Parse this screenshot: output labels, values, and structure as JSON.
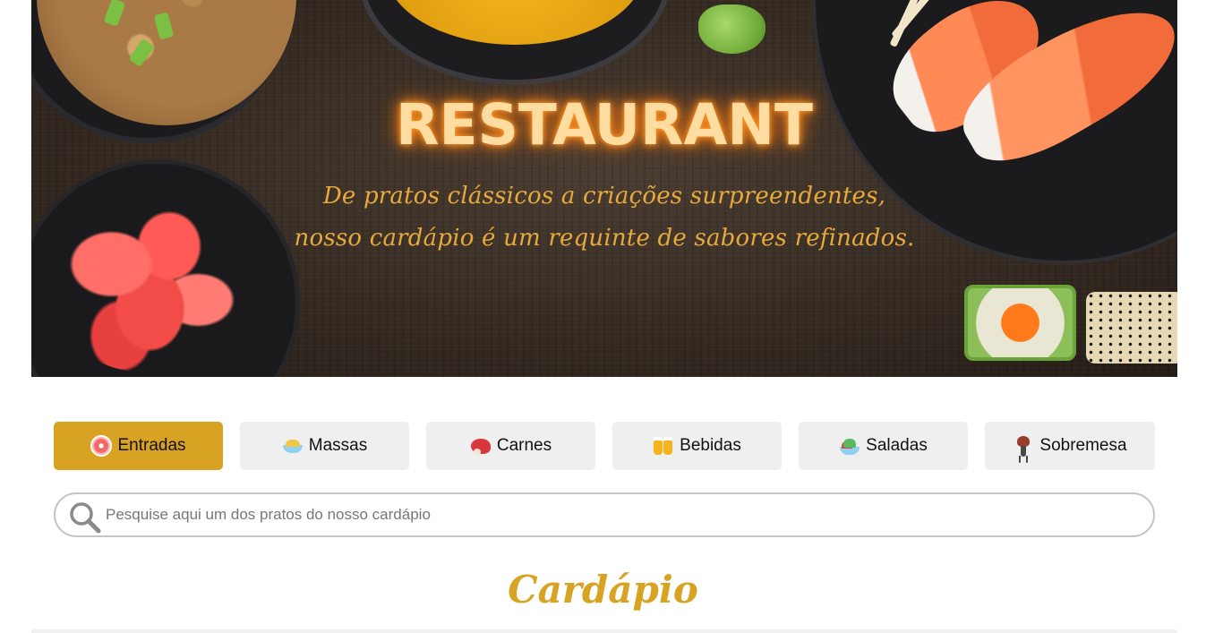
{
  "hero": {
    "title": "RESTAURANT",
    "subtitle": "De pratos clássicos a criações surpreendentes, nosso cardápio é um requinte de sabores refinados."
  },
  "categories": [
    {
      "label": "Entradas",
      "icon": "appetizer-icon",
      "active": true
    },
    {
      "label": "Massas",
      "icon": "pasta-icon",
      "active": false
    },
    {
      "label": "Carnes",
      "icon": "meat-icon",
      "active": false
    },
    {
      "label": "Bebidas",
      "icon": "beer-mugs-icon",
      "active": false
    },
    {
      "label": "Saladas",
      "icon": "salad-icon",
      "active": false
    },
    {
      "label": "Sobremesa",
      "icon": "dessert-icon",
      "active": false
    }
  ],
  "search": {
    "placeholder": "Pesquise aqui um dos pratos do nosso cardápio",
    "icon": "search-icon"
  },
  "menu": {
    "title": "Cardápio"
  },
  "colors": {
    "accent": "#d8a322",
    "button_bg": "#efefef",
    "title_glow": "#ff8a1a",
    "subtitle": "#e7a93a"
  }
}
